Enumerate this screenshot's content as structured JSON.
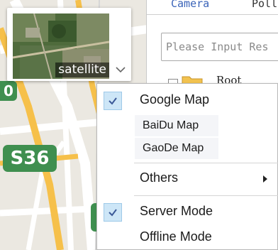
{
  "map": {
    "route_badges": [
      "S36",
      "0"
    ]
  },
  "maptype": {
    "label": "satellite"
  },
  "panel": {
    "tabs": [
      "Camera",
      "Poll"
    ],
    "search_placeholder": "Please Input Res",
    "tree_root_label": "Root"
  },
  "menu": {
    "items": [
      {
        "label": "Google Map",
        "checked": true
      },
      {
        "label": "BaiDu Map",
        "checked": false
      },
      {
        "label": "GaoDe Map",
        "checked": false
      },
      {
        "label": "Others",
        "checked": false
      },
      {
        "label": "Server Mode",
        "checked": true
      },
      {
        "label": "Offline Mode",
        "checked": false
      }
    ]
  },
  "colors": {
    "route_badge": "#3f8f4f",
    "highway": "#f6c04a",
    "checkbox": "#cde6f7",
    "tab_active": "#3a63b8"
  }
}
